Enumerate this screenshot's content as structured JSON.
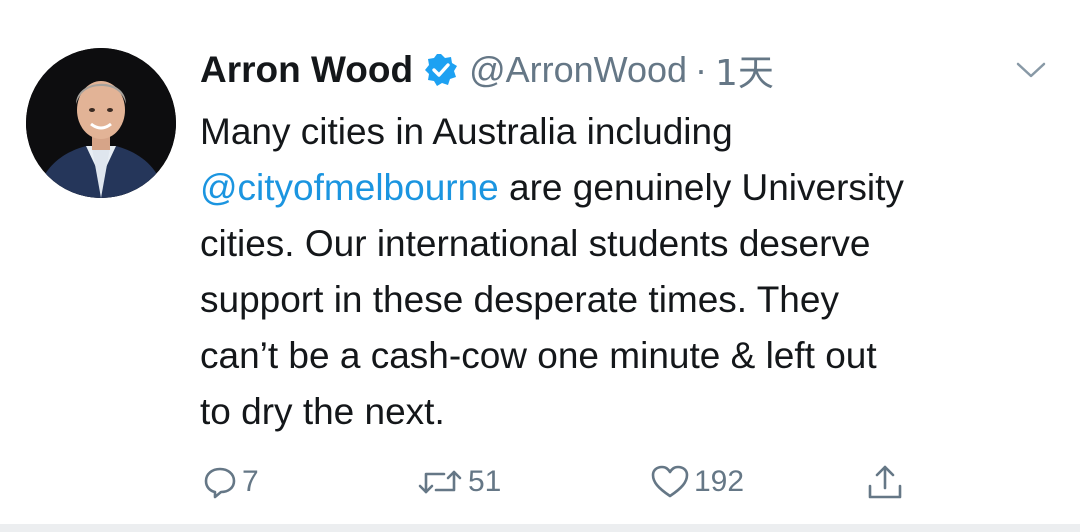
{
  "tweet": {
    "author_name": "Arron Wood",
    "handle": "@ArronWood",
    "separator": "·",
    "time": "1天",
    "text_lines": [
      "Many cities in Australia including",
      "are genuinely University",
      "cities. Our international students deserve",
      "support in these desperate times. They",
      "can’t be a cash-cow one minute & left out",
      "to dry the next."
    ],
    "mention": "@cityofmelbourne",
    "counts": {
      "replies": "7",
      "retweets": "51",
      "likes": "192"
    }
  },
  "colors": {
    "text": "#14171a",
    "secondary": "#657786",
    "link": "#1b95e0",
    "verified": "#1da1f2"
  },
  "icons": [
    "verified-badge-icon",
    "chevron-down-icon",
    "reply-icon",
    "retweet-icon",
    "like-icon",
    "share-icon"
  ]
}
